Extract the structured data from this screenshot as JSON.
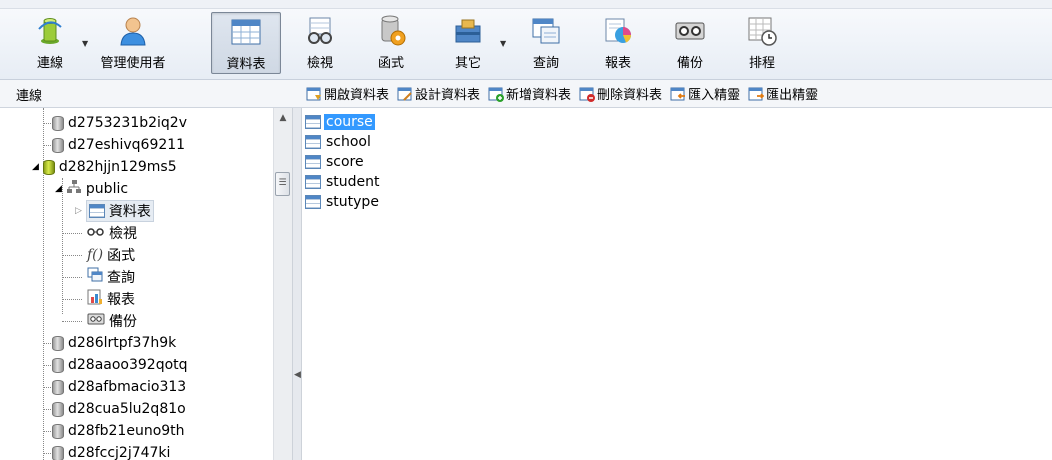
{
  "toolbar": {
    "connect": "連線",
    "manage_users": "管理使用者",
    "tables": "資料表",
    "views": "檢視",
    "functions": "函式",
    "others": "其它",
    "query": "查詢",
    "report": "報表",
    "backup": "備份",
    "schedule": "排程"
  },
  "connection_title": "連線",
  "subtoolbar": {
    "open_table": "開啟資料表",
    "design_table": "設計資料表",
    "new_table": "新增資料表",
    "delete_table": "刪除資料表",
    "import_wizard": "匯入精靈",
    "export_wizard": "匯出精靈"
  },
  "tree": {
    "db1": "d2753231b2iq2v",
    "db2": "d27eshivq69211",
    "db3": "d282hjjn129ms5",
    "schema": "public",
    "node_tables": "資料表",
    "node_views": "檢視",
    "node_functions": "函式",
    "node_queries": "查詢",
    "node_reports": "報表",
    "node_backups": "備份",
    "db4": "d286lrtpf37h9k",
    "db5": "d28aaoo392qotq",
    "db6": "d28afbmacio313",
    "db7": "d28cua5lu2q81o",
    "db8": "d28fb21euno9th",
    "db9": "d28fccj2j747ki"
  },
  "tables": [
    "course",
    "school",
    "score",
    "student",
    "stutype"
  ]
}
